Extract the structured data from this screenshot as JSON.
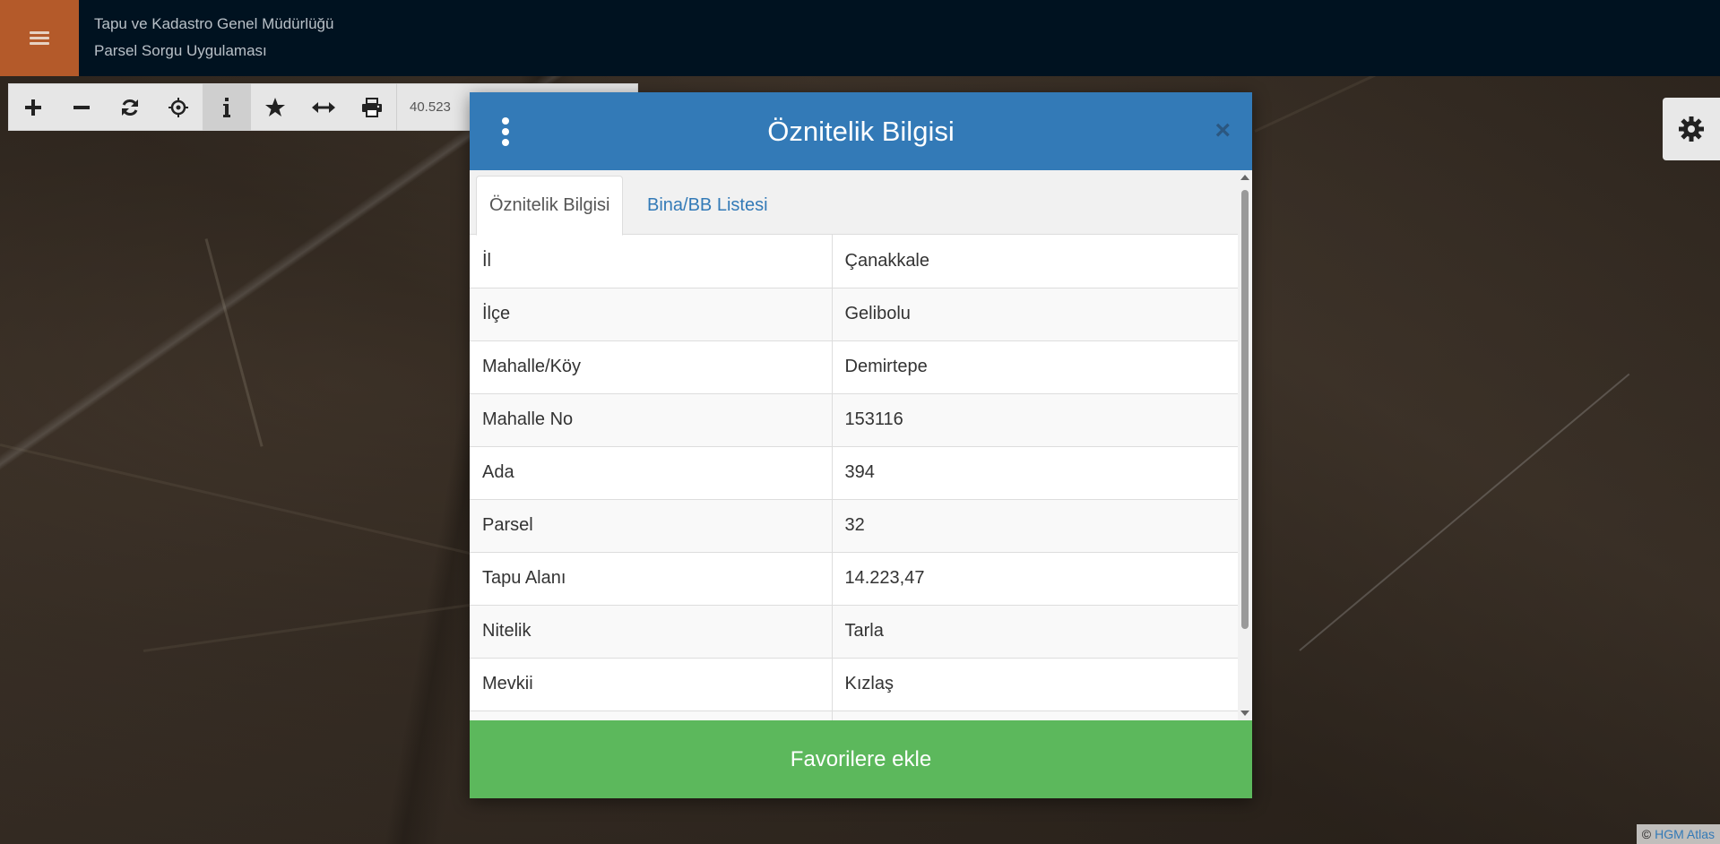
{
  "header": {
    "line1": "Tapu ve Kadastro Genel Müdürlüğü",
    "line2": "Parsel Sorgu Uygulaması"
  },
  "toolbar": {
    "coordinate": "40.523"
  },
  "dialog": {
    "title": "Öznitelik Bilgisi",
    "close_label": "×",
    "tabs": [
      {
        "label": "Öznitelik Bilgisi"
      },
      {
        "label": "Bina/BB Listesi"
      }
    ],
    "rows": [
      {
        "key": "İl",
        "value": "Çanakkale"
      },
      {
        "key": "İlçe",
        "value": "Gelibolu"
      },
      {
        "key": "Mahalle/Köy",
        "value": "Demirtepe"
      },
      {
        "key": "Mahalle No",
        "value": "153116"
      },
      {
        "key": "Ada",
        "value": "394"
      },
      {
        "key": "Parsel",
        "value": "32"
      },
      {
        "key": "Tapu Alanı",
        "value": "14.223,47"
      },
      {
        "key": "Nitelik",
        "value": "Tarla"
      },
      {
        "key": "Mevkii",
        "value": "Kızlaş"
      }
    ],
    "favorite_button": "Favorilere ekle"
  },
  "attribution": {
    "copyright": "©",
    "source": "HGM Atlas"
  },
  "icons": {
    "menu": "hamburger-icon",
    "zoom_in": "plus-icon",
    "zoom_out": "minus-icon",
    "refresh": "refresh-icon",
    "locate": "crosshair-icon",
    "info": "info-icon",
    "favorite": "star-icon",
    "measure": "arrows-horizontal-icon",
    "print": "print-icon",
    "settings": "gear-icon",
    "options": "kebab-icon",
    "close": "close-icon"
  },
  "colors": {
    "header_bg": "#001220",
    "menu_bg": "#b45a2a",
    "dialog_header": "#337ab7",
    "favorite_button": "#5cb85c"
  }
}
